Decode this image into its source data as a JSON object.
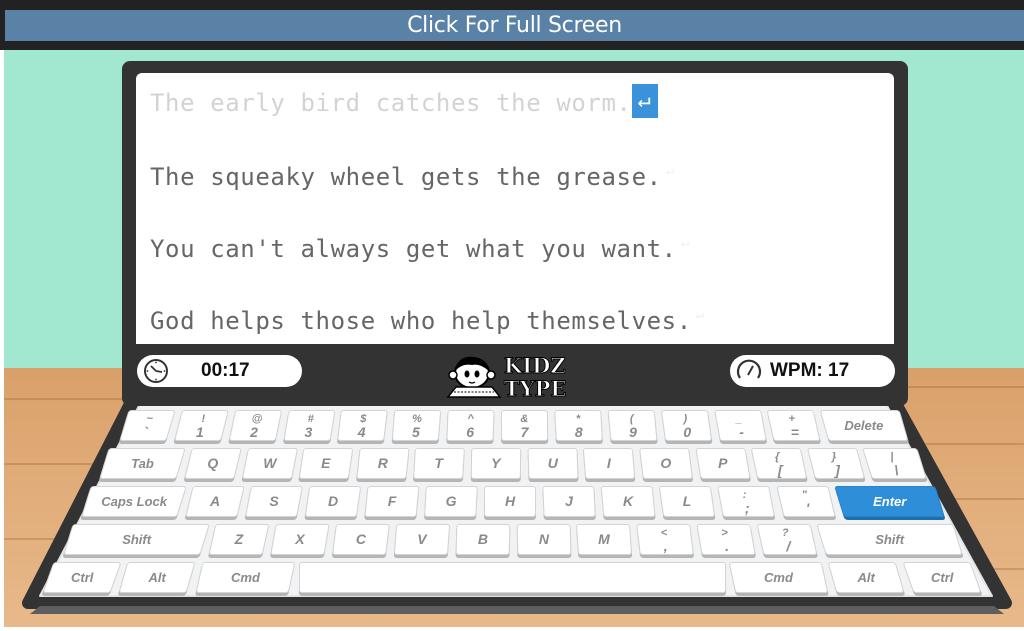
{
  "topbar": {
    "fullscreen_label": "Click For Full Screen"
  },
  "colors": {
    "accent": "#3a92db",
    "wall": "#a2e7d0",
    "bezel": "#333333",
    "topbar": "#5a81a6"
  },
  "lines": [
    {
      "text": "The early bird catches the worm.",
      "state": "completed",
      "end_marker": "↵"
    },
    {
      "text": "The squeaky wheel gets the grease.",
      "state": "pending",
      "end_marker": "↵"
    },
    {
      "text": "You can't always get what you want.",
      "state": "pending",
      "end_marker": "↵"
    },
    {
      "text": "God helps those who help themselves.",
      "state": "pending",
      "end_marker": "↵"
    }
  ],
  "status": {
    "timer_icon": "clock-icon",
    "timer": "00:17",
    "wpm_icon": "speedometer-icon",
    "wpm": "WPM: 17"
  },
  "logo": {
    "line1": "KIDZ",
    "line2": "TYPE"
  },
  "keyboard": {
    "highlighted_key": "Enter",
    "rows": [
      [
        [
          "~",
          "`"
        ],
        [
          "!",
          "1"
        ],
        [
          "@",
          "2"
        ],
        [
          "#",
          "3"
        ],
        [
          "$",
          "4"
        ],
        [
          "%",
          "5"
        ],
        [
          "^",
          "6"
        ],
        [
          "&",
          "7"
        ],
        [
          "*",
          "8"
        ],
        [
          "(",
          "9"
        ],
        [
          ")",
          "0"
        ],
        [
          "_",
          "-"
        ],
        [
          "+",
          "="
        ],
        [
          "",
          "Delete"
        ]
      ],
      [
        [
          "",
          "Tab"
        ],
        [
          "",
          "Q"
        ],
        [
          "",
          "W"
        ],
        [
          "",
          "E"
        ],
        [
          "",
          "R"
        ],
        [
          "",
          "T"
        ],
        [
          "",
          "Y"
        ],
        [
          "",
          "U"
        ],
        [
          "",
          "I"
        ],
        [
          "",
          "O"
        ],
        [
          "",
          "P"
        ],
        [
          "{",
          "["
        ],
        [
          "}",
          "]"
        ],
        [
          "|",
          "\\"
        ]
      ],
      [
        [
          "",
          "Caps Lock"
        ],
        [
          "",
          "A"
        ],
        [
          "",
          "S"
        ],
        [
          "",
          "D"
        ],
        [
          "",
          "F"
        ],
        [
          "",
          "G"
        ],
        [
          "",
          "H"
        ],
        [
          "",
          "J"
        ],
        [
          "",
          "K"
        ],
        [
          "",
          "L"
        ],
        [
          ":",
          ";"
        ],
        [
          "\"",
          "'"
        ],
        [
          "",
          "Enter"
        ]
      ],
      [
        [
          "",
          "Shift"
        ],
        [
          "",
          "Z"
        ],
        [
          "",
          "X"
        ],
        [
          "",
          "C"
        ],
        [
          "",
          "V"
        ],
        [
          "",
          "B"
        ],
        [
          "",
          "N"
        ],
        [
          "",
          "M"
        ],
        [
          "<",
          ","
        ],
        [
          ">",
          "."
        ],
        [
          "?",
          "/"
        ],
        [
          "",
          "Shift"
        ]
      ],
      [
        [
          "",
          "Ctrl"
        ],
        [
          "",
          "Alt"
        ],
        [
          "",
          "Cmd"
        ],
        [
          "",
          ""
        ],
        [
          "",
          "Cmd"
        ],
        [
          "",
          "Alt"
        ],
        [
          "",
          "Ctrl"
        ]
      ]
    ]
  }
}
